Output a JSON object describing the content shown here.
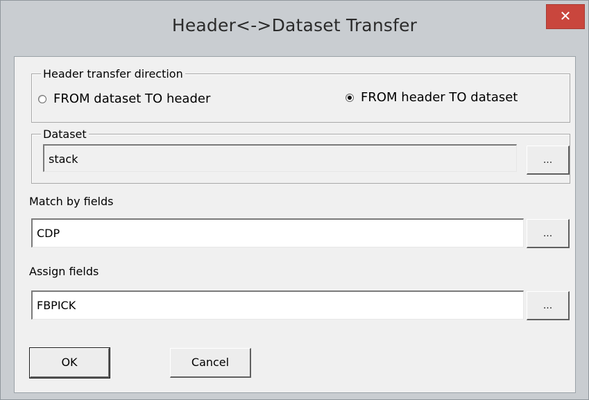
{
  "window": {
    "title": "Header<->Dataset Transfer",
    "close_label": "✕"
  },
  "direction": {
    "legend": "Header transfer direction",
    "option_dataset_to_header": "FROM dataset TO header",
    "option_header_to_dataset": "FROM header TO dataset",
    "selected": "FROM header TO dataset"
  },
  "dataset": {
    "legend": "Dataset",
    "value": "stack",
    "browse_label": "..."
  },
  "match_fields": {
    "label": "Match by fields",
    "value": "CDP",
    "browse_label": "..."
  },
  "assign_fields": {
    "label": "Assign fields",
    "value": "FBPICK",
    "browse_label": "..."
  },
  "buttons": {
    "ok_label": "OK",
    "cancel_label": "Cancel"
  }
}
